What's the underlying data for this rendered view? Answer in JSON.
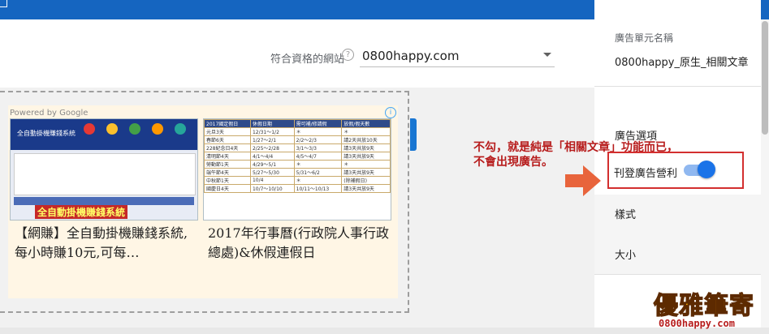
{
  "site": {
    "label": "符合資格的網站",
    "value": "0800happy.com"
  },
  "ad_preview": {
    "powered_by": "Powered by Google",
    "info_symbol": "i",
    "cards": [
      {
        "title": "【網賺】全自動掛機賺錢系統,每小時賺10元,可每…",
        "thumb_banner": "全自動掛機賺錢系統",
        "thumb_header": "全自動掛機賺錢系統"
      },
      {
        "title": "2017年行事曆(行政院人事行政總處)&休假連假日",
        "table_header": [
          "2017國定假日",
          "休假日期",
          "需可補/修請假",
          "放假/假天數"
        ],
        "table_rows": [
          [
            "元旦3天",
            "12/31～1/2",
            "＊",
            "＊"
          ],
          [
            "春節6天",
            "1/27～2/1",
            "2/2～2/3",
            "請2天共放10天"
          ],
          [
            "228紀念日4天",
            "2/25～2/28",
            "3/1～3/3",
            "請3天共放9天"
          ],
          [
            "清明節4天",
            "4/1～4/4",
            "4/5～4/7",
            "請3天共放9天"
          ],
          [
            "勞動節1天",
            "4/29～5/1",
            "＊",
            "＊"
          ],
          [
            "端午節4天",
            "5/27～5/30",
            "5/31～6/2",
            "請3天共放9天"
          ],
          [
            "中秋節1天",
            "10/4",
            "＊",
            "(除補假日)"
          ],
          [
            "國慶日4天",
            "10/7～10/10",
            "10/11～10/13",
            "請3天共放9天"
          ]
        ]
      }
    ]
  },
  "sidebar": {
    "unit_name_label": "廣告單元名稱",
    "unit_name_value": "0800happy_原生_相關文章",
    "ad_options_label": "廣告選項",
    "publish_toggle_label": "刊登廣告營利",
    "publish_toggle_on": true,
    "style_label": "樣式",
    "size_label": "大小"
  },
  "annotation": {
    "line1": "不勾，就是純是「相關文章」功能而已，",
    "line2": "不會出現廣告。"
  },
  "watermark": {
    "big": "優雅筆寄",
    "small": "0800happy.com"
  },
  "colors": {
    "primary": "#1a73e8",
    "annotation_red": "#b71c1c",
    "arrow_orange": "#e8643c"
  }
}
